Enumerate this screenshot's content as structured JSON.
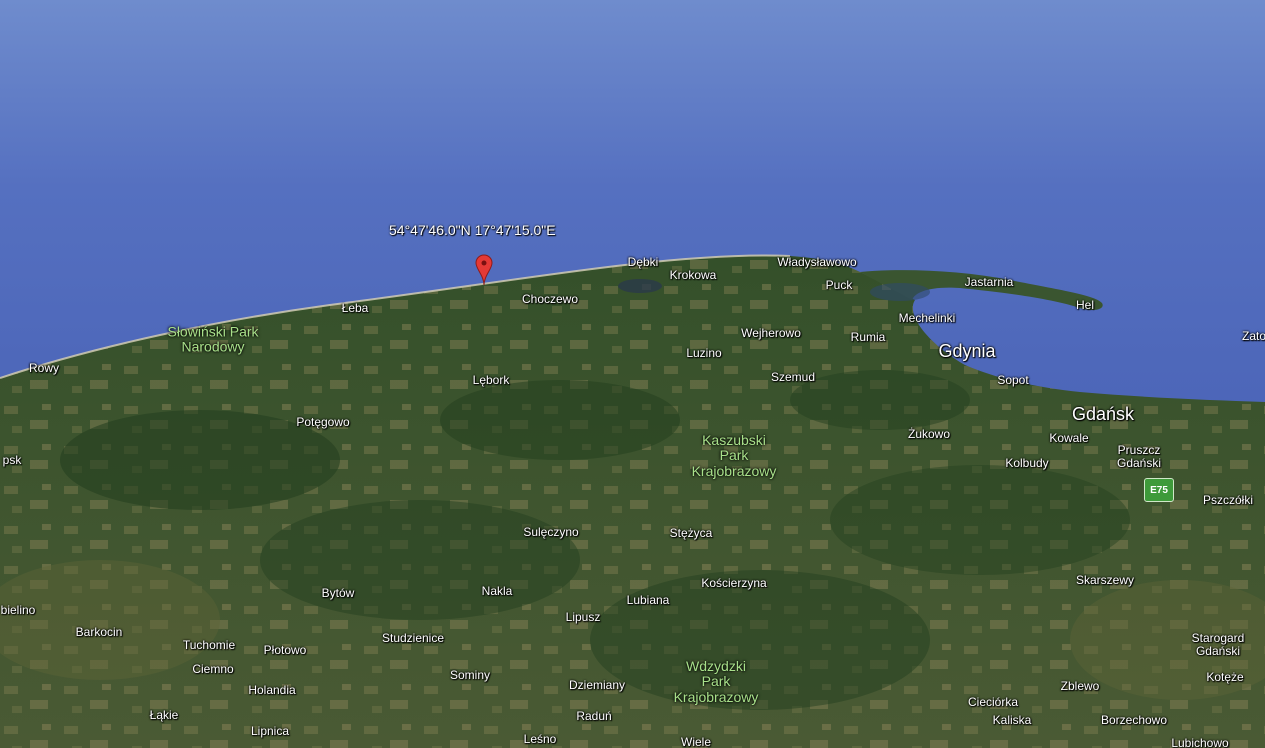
{
  "map": {
    "marker_coordinates": "54°47'46.0\"N 17°47'15.0\"E",
    "road_badge": "E75",
    "colors": {
      "sea": "#4a62b5",
      "land": "#3d5a2e",
      "forest": "#24401f",
      "park_text": "#a8e08a",
      "pin": "#e53935"
    },
    "places": {
      "rowy": "Rowy",
      "leba": "Łeba",
      "slowinski_line1": "Słowiński Park",
      "slowinski_line2": "Narodowy",
      "debki": "Dębki",
      "krokowa": "Krokowa",
      "choczewo": "Choczewo",
      "wladyslawowo": "Władysławowo",
      "jastarnia": "Jastarnia",
      "hel": "Hel",
      "puck": "Puck",
      "mechelinki": "Mechelinki",
      "wejherowo": "Wejherowo",
      "rumia": "Rumia",
      "gdynia": "Gdynia",
      "zatoka": "Zato",
      "luzino": "Luzino",
      "sopot": "Sopot",
      "lebork": "Lębork",
      "szemud": "Szemud",
      "gdansk": "Gdańsk",
      "potegowo": "Potęgowo",
      "zukowo": "Żukowo",
      "kowale": "Kowale",
      "kaszubski_line1": "Kaszubski",
      "kaszubski_line2": "Park",
      "kaszubski_line3": "Krajobrazowy",
      "pruszcz_line1": "Pruszcz",
      "pruszcz_line2": "Gdański",
      "psk": "psk",
      "kolbudy": "Kolbudy",
      "pszczolki": "Pszczółki",
      "sulecz": "Sulęczyno",
      "stezyca": "Stężyca",
      "koscierzyna": "Kościerzyna",
      "skarszewy": "Skarszewy",
      "bytow": "Bytów",
      "nakla": "Nakla",
      "lubiana": "Lubiana",
      "bielino": "bielino",
      "lipusz": "Lipusz",
      "barkocin": "Barkocin",
      "tuchomie": "Tuchomie",
      "studzienice": "Studzienice",
      "piotowo": "Płotowo",
      "starogard_line1": "Starogard",
      "starogard_line2": "Gdański",
      "ciemno": "Ciemno",
      "wdzydzki_line1": "Wdzydzki",
      "wdzydzki_line2": "Park",
      "wdzydzki_line3": "Krajobrazowy",
      "sominy": "Sominy",
      "koteze": "Kotęże",
      "holandia": "Holandia",
      "dziemiany": "Dziemiany",
      "zblewo": "Zblewo",
      "ciecholka": "Cieciórka",
      "lakie": "Łąkie",
      "radun": "Raduń",
      "kaliska": "Kaliska",
      "borzechowo": "Borzechowo",
      "lipnica": "Lipnica",
      "lesno": "Leśno",
      "wiele": "Wiele",
      "lubichowo": "Lubichowo"
    }
  }
}
